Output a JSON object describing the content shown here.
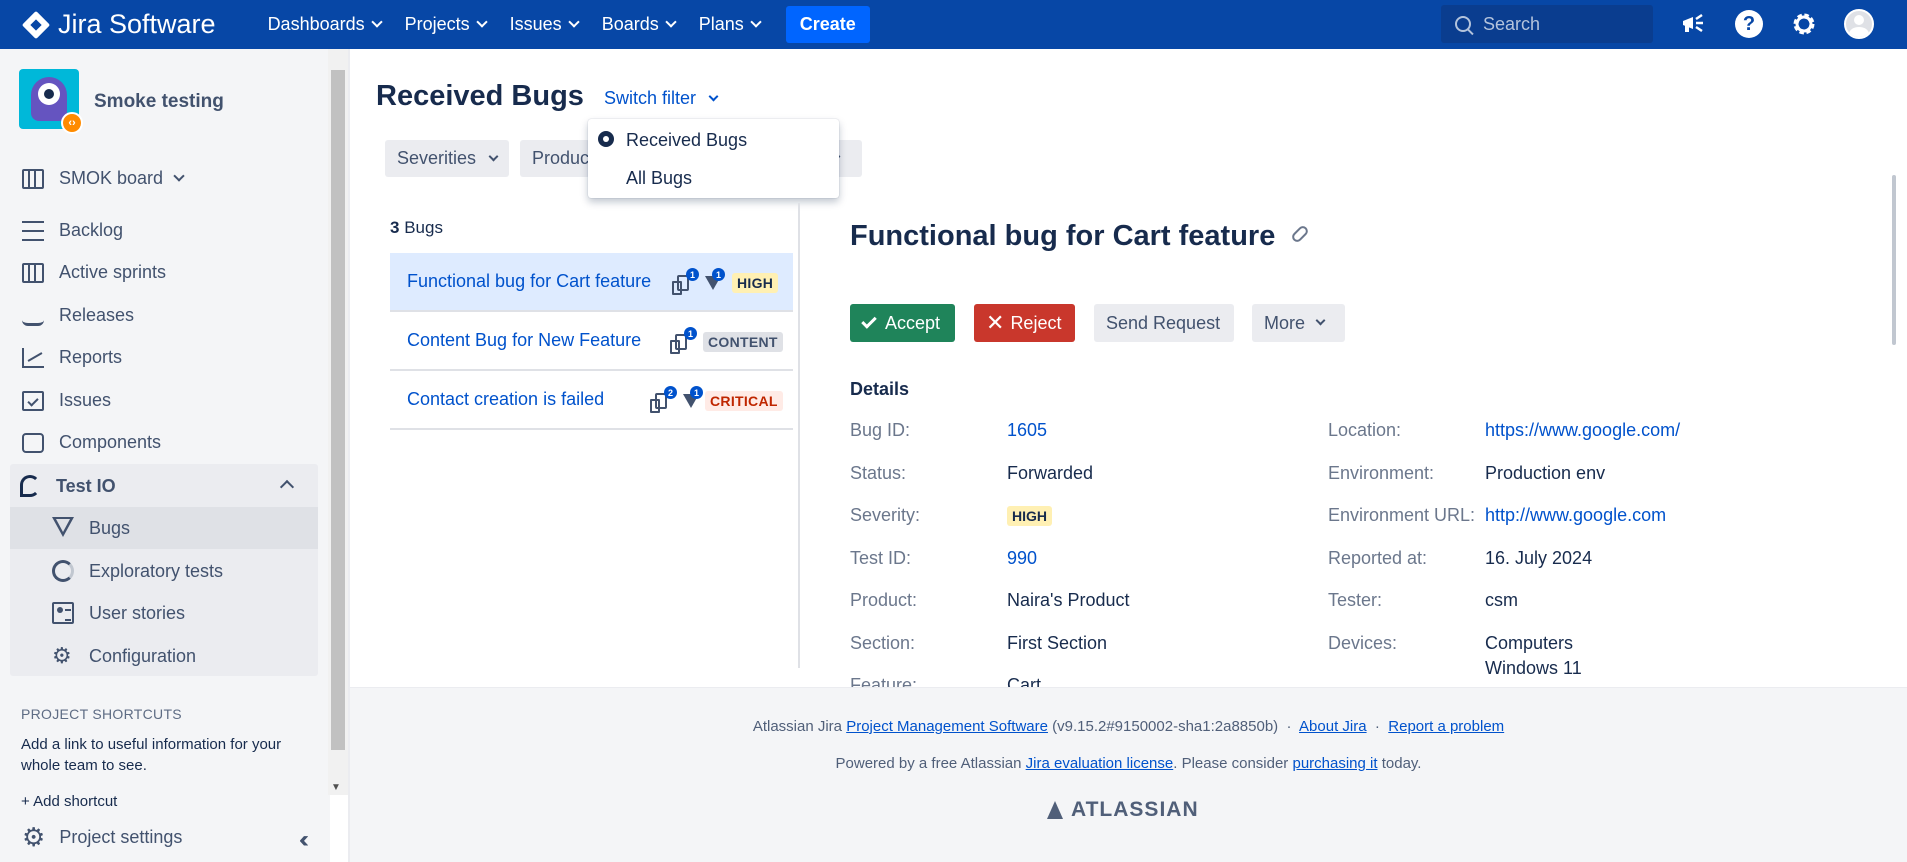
{
  "topnav": {
    "brand": "Jira Software",
    "items": [
      "Dashboards",
      "Projects",
      "Issues",
      "Boards",
      "Plans"
    ],
    "create_label": "Create",
    "search_placeholder": "Search",
    "brand_color": "#0747a6"
  },
  "sidebar": {
    "project_name": "Smoke testing",
    "board_label": "SMOK board",
    "items": [
      "Backlog",
      "Active sprints",
      "Releases",
      "Reports",
      "Issues",
      "Components"
    ],
    "testio": {
      "label": "Test IO",
      "items": [
        "Bugs",
        "Exploratory tests",
        "User stories",
        "Configuration"
      ],
      "active": "Bugs"
    },
    "shortcuts_title": "PROJECT SHORTCUTS",
    "shortcuts_text": "Add a link to useful information for your whole team to see.",
    "add_shortcut": "Add shortcut",
    "settings_label": "Project settings"
  },
  "main": {
    "title": "Received Bugs",
    "switch_filter": "Switch filter",
    "filters": [
      "Severities",
      "Produc"
    ],
    "filter_dropdown": {
      "options": [
        "Received Bugs",
        "All Bugs"
      ],
      "selected": "Received Bugs"
    },
    "list": {
      "count": "3",
      "count_label": "Bugs",
      "bugs": [
        {
          "title": "Functional bug for Cart feature",
          "devices": "1",
          "tests": "1",
          "severity": "HIGH"
        },
        {
          "title": "Content Bug for New Feature",
          "devices": "1",
          "severity": "CONTENT"
        },
        {
          "title": "Contact creation is failed",
          "devices": "2",
          "tests": "1",
          "severity": "CRITICAL"
        }
      ]
    },
    "detail": {
      "title": "Functional bug for Cart feature",
      "buttons": {
        "accept": "Accept",
        "reject": "Reject",
        "send_request": "Send Request",
        "more": "More"
      },
      "details_heading": "Details",
      "left": [
        {
          "label": "Bug ID:",
          "value": "1605"
        },
        {
          "label": "Status:",
          "value": "Forwarded"
        },
        {
          "label": "Severity:",
          "value": "HIGH"
        },
        {
          "label": "Test ID:",
          "value": "990"
        },
        {
          "label": "Product:",
          "value": "Naira's Product"
        },
        {
          "label": "Section:",
          "value": "First Section"
        },
        {
          "label": "Feature:",
          "value": "Cart"
        }
      ],
      "right": [
        {
          "label": "Location:",
          "value": "https://www.google.com/"
        },
        {
          "label": "Environment:",
          "value": "Production env"
        },
        {
          "label": "Environment URL:",
          "value": "http://www.google.com"
        },
        {
          "label": "Reported at:",
          "value": "16. July 2024"
        },
        {
          "label": "Tester:",
          "value": "csm"
        },
        {
          "label": "Devices:",
          "value": "Computers"
        },
        {
          "label": "",
          "value": "Windows 11"
        }
      ]
    }
  },
  "footer": {
    "line1_prefix": "Atlassian Jira",
    "line1_link": "Project Management Software",
    "line1_version": "(v9.15.2#9150002-sha1:2a8850b)",
    "about": "About Jira",
    "report": "Report a problem",
    "line2_prefix": "Powered by a free Atlassian",
    "line2_link": "Jira evaluation license",
    "line2_mid": ". Please consider",
    "line2_link2": "purchasing it",
    "line2_suffix": "today.",
    "logo_text": "ATLASSIAN",
    "separator": "·"
  }
}
